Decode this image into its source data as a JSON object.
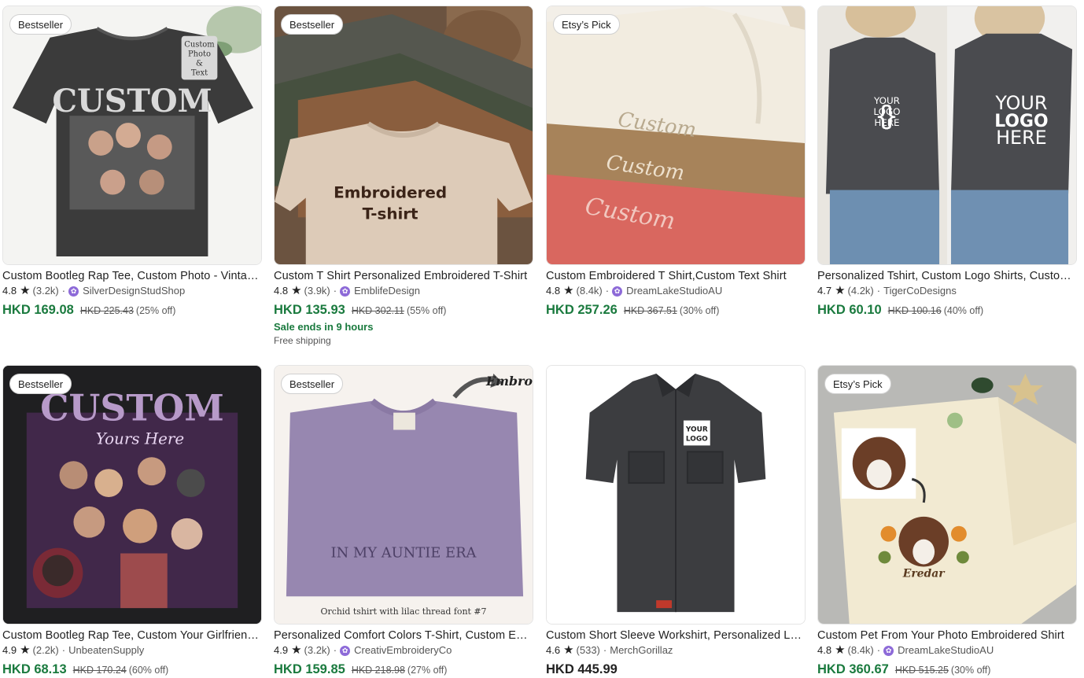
{
  "colors": {
    "sale_green": "#1a7a3e",
    "star_seller_purple": "#8d6ad8",
    "text": "#222222"
  },
  "listings": [
    {
      "badge": "Bestseller",
      "title": "Custom Bootleg Rap Tee, Custom Photo - Vintage Bootleg Tee",
      "rating": "4.8",
      "count": "(3.2k)",
      "shop": "SilverDesignStudShop",
      "star_seller": true,
      "price": "HKD 169.08",
      "original_price": "HKD 225.43",
      "discount": "(25% off)",
      "sale_note": "",
      "shipping": "",
      "image": {
        "name": "custom-photo-bootleg-tee-image",
        "text": [
          "CUSTOM",
          "Custom",
          "Photo",
          "&",
          "Text"
        ]
      }
    },
    {
      "badge": "Bestseller",
      "title": "Custom T Shirt Personalized Embroidered T-Shirt",
      "rating": "4.8",
      "count": "(3.9k)",
      "shop": "EmblifeDesign",
      "star_seller": true,
      "price": "HKD 135.93",
      "original_price": "HKD 302.11",
      "discount": "(55% off)",
      "sale_note": "Sale ends in 9 hours",
      "shipping": "Free shipping",
      "image": {
        "name": "embroidered-tshirt-stack-image",
        "text": [
          "Embroidered",
          "T-shirt"
        ]
      }
    },
    {
      "badge": "Etsy’s Pick",
      "title": "Custom Embroidered T Shirt,Custom Text Shirt",
      "rating": "4.8",
      "count": "(8.4k)",
      "shop": "DreamLakeStudioAU",
      "star_seller": true,
      "price": "HKD 257.26",
      "original_price": "HKD 367.51",
      "discount": "(30% off)",
      "sale_note": "",
      "shipping": "",
      "image": {
        "name": "folded-custom-tshirts-image",
        "text": [
          "Custom",
          "Custom",
          "Custom"
        ]
      }
    },
    {
      "badge": "",
      "title": "Personalized Tshirt, Custom Logo Shirts, Custom Shirts",
      "rating": "4.7",
      "count": "(4.2k)",
      "shop": "TigerCoDesigns",
      "star_seller": false,
      "price": "HKD 60.10",
      "original_price": "HKD 100.16",
      "discount": "(40% off)",
      "sale_note": "",
      "shipping": "",
      "image": {
        "name": "your-logo-here-tshirt-image",
        "text": [
          "YOUR",
          "LOGO",
          "HERE"
        ]
      }
    },
    {
      "badge": "Bestseller",
      "title": "Custom Bootleg Rap Tee, Custom Your Girlfriend Photo Tee",
      "rating": "4.9",
      "count": "(2.2k)",
      "shop": "UnbeatenSupply",
      "star_seller": false,
      "price": "HKD 68.13",
      "original_price": "HKD 170.24",
      "discount": "(60% off)",
      "sale_note": "",
      "shipping": "",
      "image": {
        "name": "custom-girlfriend-bootleg-tee-image",
        "text": [
          "CUSTOM",
          "Yours Here"
        ]
      }
    },
    {
      "badge": "Bestseller",
      "title": "Personalized Comfort Colors T-Shirt, Custom Embroidered",
      "rating": "4.9",
      "count": "(3.2k)",
      "shop": "CreativEmbroideryCo",
      "star_seller": true,
      "price": "HKD 159.85",
      "original_price": "HKD 218.98",
      "discount": "(27% off)",
      "sale_note": "",
      "shipping": "",
      "image": {
        "name": "auntie-era-orchid-tshirt-image",
        "text": [
          "IN MY AUNTIE ERA",
          "Orchid tshirt with lilac thread font #7",
          "Embro"
        ]
      }
    },
    {
      "badge": "",
      "title": "Custom Short Sleeve Workshirt, Personalized Logo Workshirt",
      "rating": "4.6",
      "count": "(533)",
      "shop": "MerchGorillaz",
      "star_seller": false,
      "price": "HKD 445.99",
      "original_price": "",
      "discount": "",
      "sale_note": "",
      "shipping": "",
      "image": {
        "name": "logo-workshirt-image",
        "text": [
          "YOUR",
          "LOGO"
        ]
      }
    },
    {
      "badge": "Etsy’s Pick",
      "title": "Custom Pet From Your Photo Embroidered Shirt",
      "rating": "4.8",
      "count": "(8.4k)",
      "shop": "DreamLakeStudioAU",
      "star_seller": true,
      "price": "HKD 360.67",
      "original_price": "HKD 515.25",
      "discount": "(30% off)",
      "sale_note": "",
      "shipping": "",
      "image": {
        "name": "pet-embroidered-shirt-image",
        "text": [
          "Eredar"
        ]
      }
    }
  ]
}
